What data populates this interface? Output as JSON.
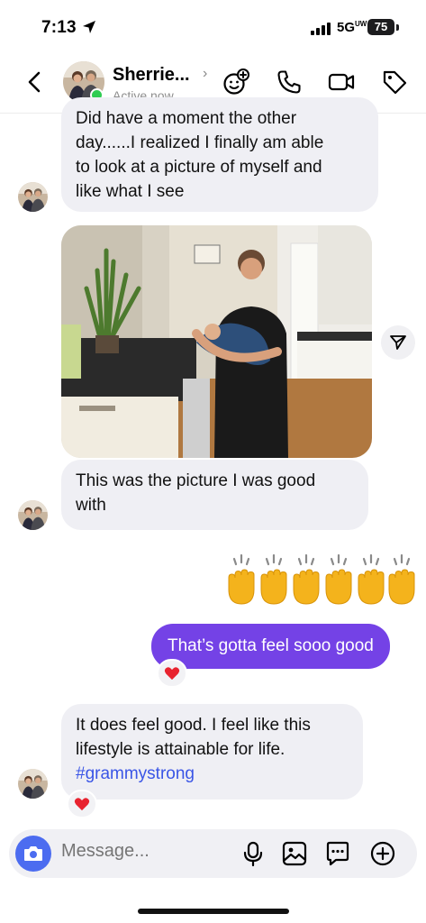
{
  "status_bar": {
    "time": "7:13",
    "network": "5G",
    "network_sup": "UW",
    "battery": "75"
  },
  "header": {
    "contact_name": "Sherrie...",
    "active_status": "Active now",
    "icons": [
      "back-arrow-icon",
      "add-emoji-icon",
      "phone-icon",
      "video-icon",
      "tag-icon"
    ]
  },
  "messages": [
    {
      "direction": "incoming",
      "lines": [
        "Did have a moment the other",
        "day......I realized I finally am able",
        "to look at a picture of myself and",
        "like what I see"
      ]
    },
    {
      "direction": "incoming",
      "type": "photo"
    },
    {
      "direction": "incoming",
      "lines": [
        "This was the picture I was good",
        "with"
      ]
    },
    {
      "direction": "outgoing",
      "type": "emoji",
      "emoji": "👏👏👏👏👏👏"
    },
    {
      "direction": "outgoing",
      "text": "That’s gotta feel sooo good",
      "reaction": "❤️"
    },
    {
      "direction": "incoming",
      "lines": [
        "It does feel good. I feel like this",
        "lifestyle is attainable for life."
      ],
      "hashtag": "#grammystrong",
      "reaction": "❤️"
    }
  ],
  "composer": {
    "placeholder": "Message...",
    "icons": [
      "camera-icon",
      "microphone-icon",
      "gallery-icon",
      "sticker-icon",
      "plus-icon"
    ]
  },
  "colors": {
    "outgoing_bubble": "#7442e6",
    "incoming_bubble": "#efeff4",
    "hashtag": "#3a55e6",
    "online": "#2fcc52",
    "camera_button": "#4c6cf0"
  }
}
